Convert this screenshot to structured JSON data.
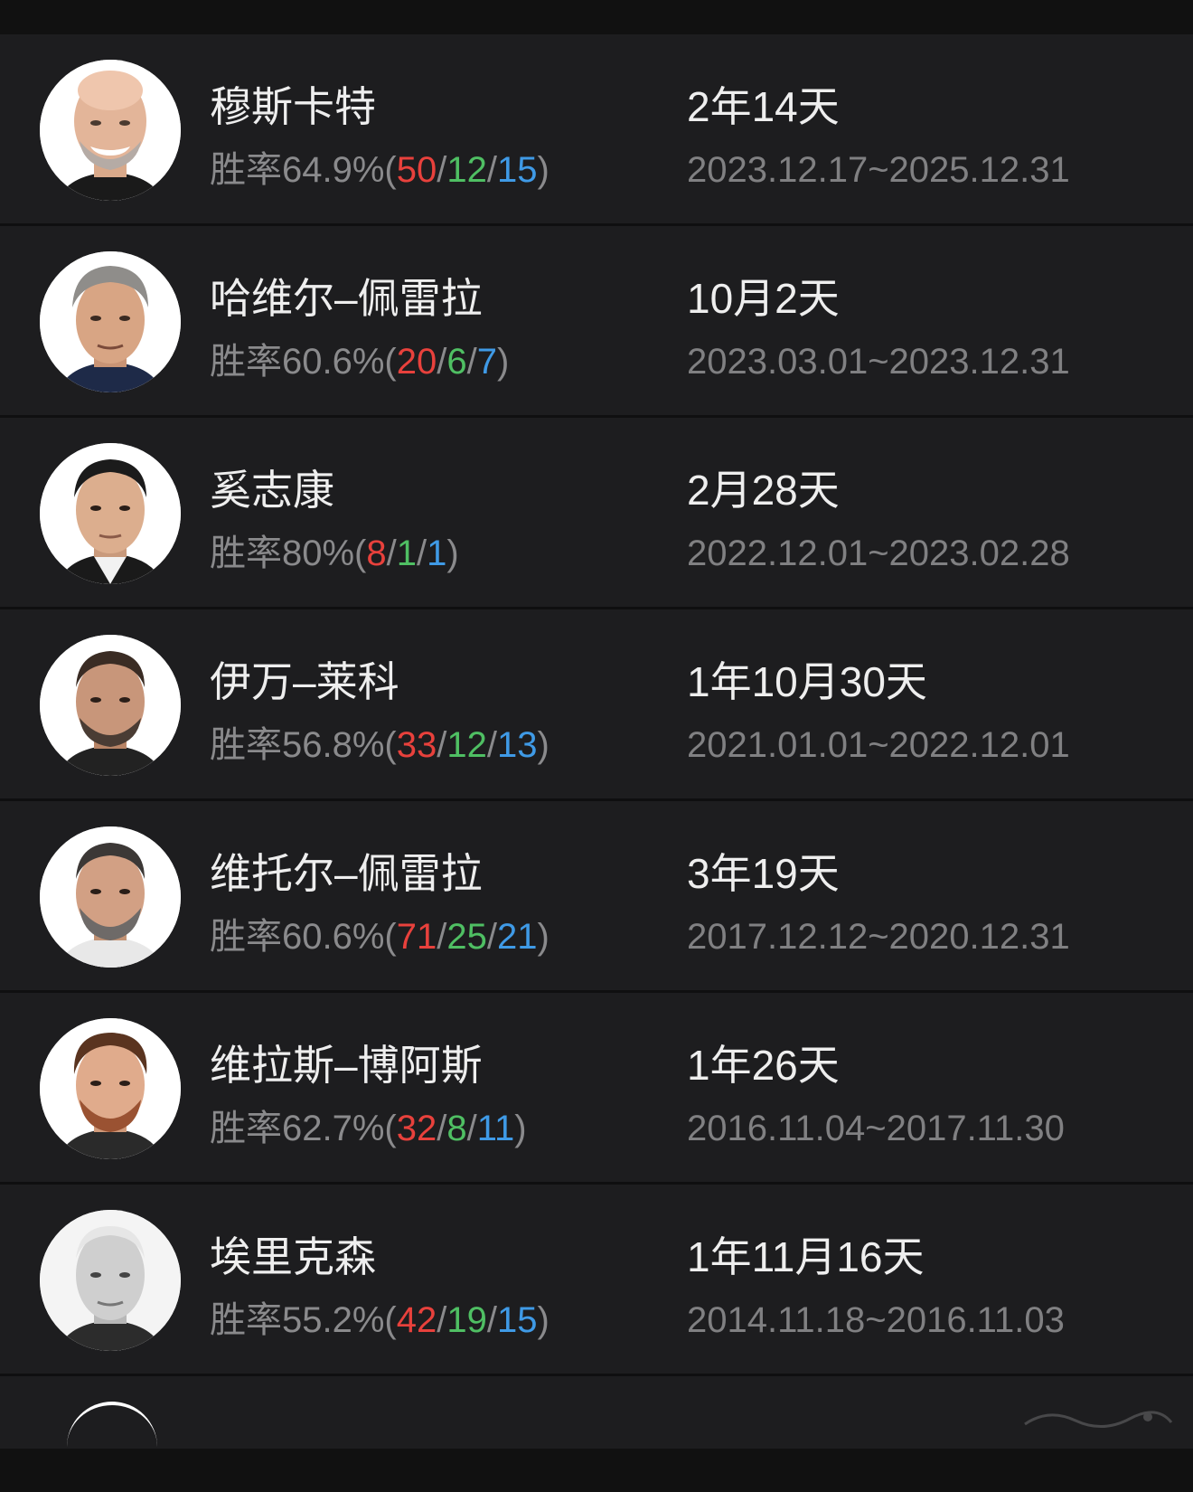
{
  "coaches": [
    {
      "name": "穆斯卡特",
      "stats_prefix": "胜率64.9%(",
      "wins": "50",
      "draws": "12",
      "losses": "15",
      "stats_suffix": ")",
      "tenure": "2年14天",
      "dates": "2023.12.17~2025.12.31",
      "avatar_icon": "coach-portrait-bald"
    },
    {
      "name": "哈维尔–佩雷拉",
      "stats_prefix": "胜率60.6%(",
      "wins": "20",
      "draws": "6",
      "losses": "7",
      "stats_suffix": ")",
      "tenure": "10月2天",
      "dates": "2023.03.01~2023.12.31",
      "avatar_icon": "coach-portrait-gray-hair"
    },
    {
      "name": "奚志康",
      "stats_prefix": "胜率80%(",
      "wins": "8",
      "draws": "1",
      "losses": "1",
      "stats_suffix": ")",
      "tenure": "2月28天",
      "dates": "2022.12.01~2023.02.28",
      "avatar_icon": "coach-portrait-dark-hair"
    },
    {
      "name": "伊万–莱科",
      "stats_prefix": "胜率56.8%(",
      "wins": "33",
      "draws": "12",
      "losses": "13",
      "stats_suffix": ")",
      "tenure": "1年10月30天",
      "dates": "2021.01.01~2022.12.01",
      "avatar_icon": "coach-portrait-beard"
    },
    {
      "name": "维托尔–佩雷拉",
      "stats_prefix": "胜率60.6%(",
      "wins": "71",
      "draws": "25",
      "losses": "21",
      "stats_suffix": ")",
      "tenure": "3年19天",
      "dates": "2017.12.12~2020.12.31",
      "avatar_icon": "coach-portrait-gray-beard"
    },
    {
      "name": "维拉斯–博阿斯",
      "stats_prefix": "胜率62.7%(",
      "wins": "32",
      "draws": "8",
      "losses": "11",
      "stats_suffix": ")",
      "tenure": "1年26天",
      "dates": "2016.11.04~2017.11.30",
      "avatar_icon": "coach-portrait-red-beard"
    },
    {
      "name": "埃里克森",
      "stats_prefix": "胜率55.2%(",
      "wins": "42",
      "draws": "19",
      "losses": "15",
      "stats_suffix": ")",
      "tenure": "1年11月16天",
      "dates": "2014.11.18~2016.11.03",
      "avatar_icon": "coach-portrait-grayscale"
    }
  ],
  "colors": {
    "background": "#1d1d1f",
    "divider": "#0f0f10",
    "win": "#e8413c",
    "draw": "#4fbf63",
    "loss": "#3f9ae6",
    "muted_text": "#8a8a8c",
    "primary_text": "#eeeeee"
  }
}
